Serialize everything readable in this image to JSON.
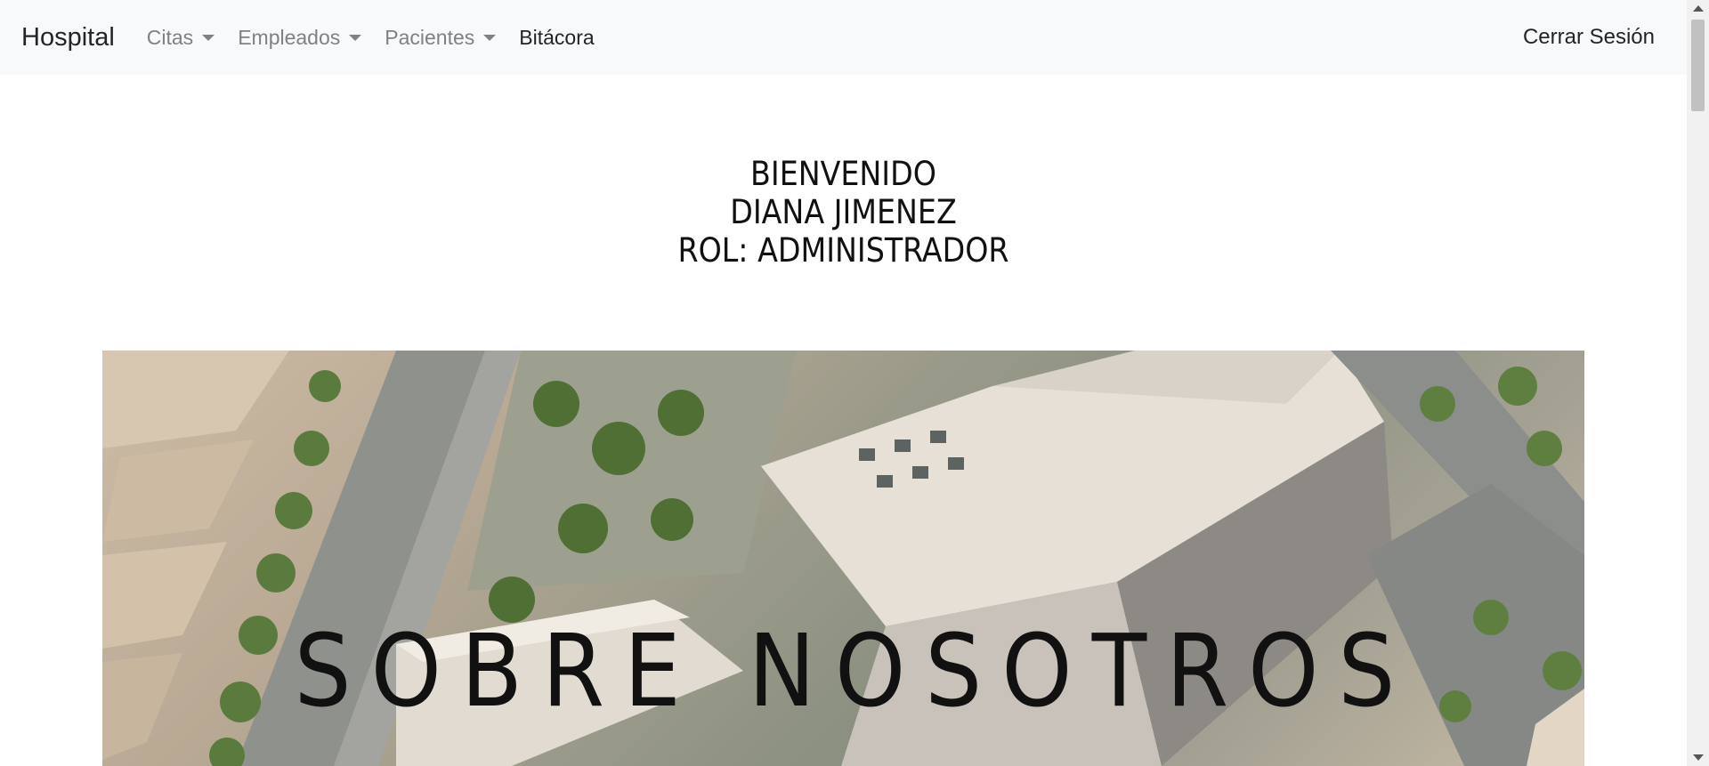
{
  "navbar": {
    "brand": "Hospital",
    "items": [
      {
        "label": "Citas",
        "dropdown": true
      },
      {
        "label": "Empleados",
        "dropdown": true
      },
      {
        "label": "Pacientes",
        "dropdown": true
      },
      {
        "label": "Bitácora",
        "dropdown": false
      }
    ],
    "logout_label": "Cerrar Sesión"
  },
  "welcome": {
    "line1": "BIENVENIDO",
    "line2": "DIANA JIMENEZ",
    "line3": "ROL: ADMINISTRADOR"
  },
  "hero": {
    "title": "SOBRE NOSOTROS"
  },
  "colors": {
    "navbar_bg": "#f8f9fa",
    "nav_muted": "#7d8287",
    "nav_active": "#212529"
  }
}
